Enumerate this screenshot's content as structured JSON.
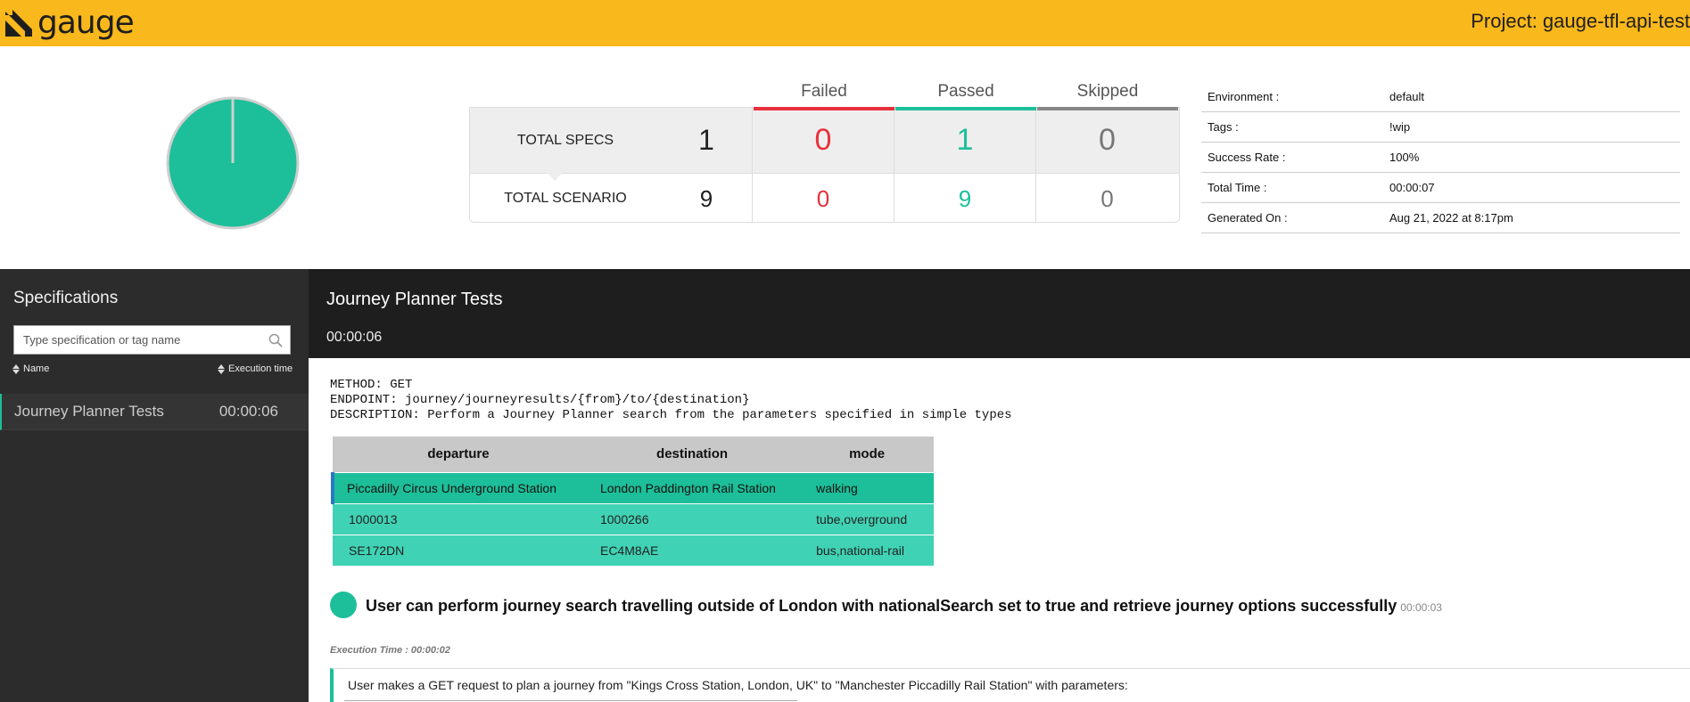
{
  "header": {
    "brand": "gauge",
    "project": "Project: gauge-tfl-api-test"
  },
  "summary": {
    "columns": [
      "Failed",
      "Passed",
      "Skipped"
    ],
    "rows": [
      {
        "label": "TOTAL SPECS",
        "total": "1",
        "failed": "0",
        "passed": "1",
        "skipped": "0"
      },
      {
        "label": "TOTAL SCENARIO",
        "total": "9",
        "failed": "0",
        "passed": "9",
        "skipped": "0"
      }
    ],
    "colors": {
      "failed": "#e8303d",
      "passed": "#1dbf9a",
      "skipped": "#777777"
    },
    "pie": {
      "passed": 1,
      "failed": 0,
      "skipped": 0
    }
  },
  "meta": [
    {
      "key": "Environment :",
      "value": "default"
    },
    {
      "key": "Tags :",
      "value": "!wip"
    },
    {
      "key": "Success Rate :",
      "value": "100%"
    },
    {
      "key": "Total Time :",
      "value": "00:00:07"
    },
    {
      "key": "Generated On :",
      "value": "Aug 21, 2022 at 8:17pm"
    }
  ],
  "sidebar": {
    "title": "Specifications",
    "search_placeholder": "Type specification or tag name",
    "sort_name": "Name",
    "sort_time": "Execution time",
    "specs": [
      {
        "name": "Journey Planner Tests",
        "time": "00:00:06"
      }
    ]
  },
  "spec": {
    "title": "Journey Planner Tests",
    "time": "00:00:06",
    "comment": "METHOD: GET\nENDPOINT: journey/journeyresults/{from}/to/{destination}\nDESCRIPTION: Perform a Journey Planner search from the parameters specified in simple types",
    "table": {
      "headers": [
        "departure",
        "destination",
        "mode"
      ],
      "rows": [
        [
          "Piccadilly Circus Underground Station",
          "London Paddington Rail Station",
          "walking"
        ],
        [
          "1000013",
          "1000266",
          "tube,overground"
        ],
        [
          "SE172DN",
          "EC4M8AE",
          "bus,national-rail"
        ]
      ]
    },
    "scenario": {
      "title": "User can perform journey search travelling outside of London with nationalSearch set to true and retrieve journey options successfully",
      "time": "00:00:03",
      "exec_time": "Execution Time : 00:00:02",
      "step": "User makes a GET request to plan a journey from \"Kings Cross Station, London, UK\" to \"Manchester Piccadilly Rail Station\" with parameters:"
    }
  }
}
